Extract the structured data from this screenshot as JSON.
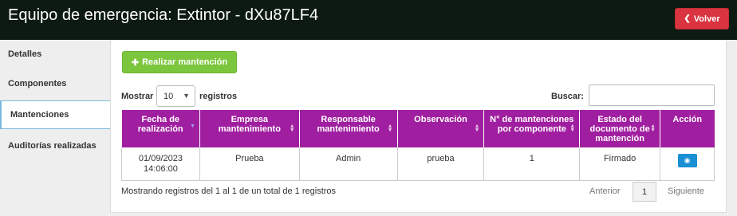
{
  "header": {
    "title": "Equipo de emergencia: Extintor - dXu87LF4",
    "back_label": "Volver",
    "back_icon": "arrow-left-icon"
  },
  "sidebar": {
    "items": [
      {
        "label": "Detalles",
        "active": false
      },
      {
        "label": "Componentes",
        "active": false
      },
      {
        "label": "Mantenciones",
        "active": true
      },
      {
        "label": "Auditorías realizadas",
        "active": false
      }
    ]
  },
  "toolbar": {
    "add_label": "Realizar mantención",
    "add_icon": "plus-icon"
  },
  "table_controls": {
    "show_label": "Mostrar",
    "length_value": "10",
    "records_label": "registros",
    "search_label": "Buscar:",
    "search_value": ""
  },
  "table": {
    "headers": [
      "Fecha de realización",
      "Empresa mantenimiento",
      "Responsable mantenimiento",
      "Observación",
      "N° de mantenciones por componente",
      "Estado del documento de mantención",
      "Acción"
    ],
    "rows": [
      {
        "fecha": "01/09/2023 14:06:00",
        "empresa": "Prueba",
        "responsable": "Admin",
        "observacion": "prueba",
        "num_mantenciones": "1",
        "estado": "Firmado",
        "accion_icon": "eye-icon"
      }
    ]
  },
  "footer": {
    "info": "Mostrando registros del 1 al 1 de un total de 1 registros",
    "prev_label": "Anterior",
    "page": "1",
    "next_label": "Siguiente"
  },
  "colors": {
    "header_bg": "#0d1a12",
    "back_button": "#d9343f",
    "add_button": "#7cc63e",
    "table_header": "#a01fa0",
    "view_button": "#1a8fd4",
    "active_tab_border": "#7ab9dc"
  }
}
